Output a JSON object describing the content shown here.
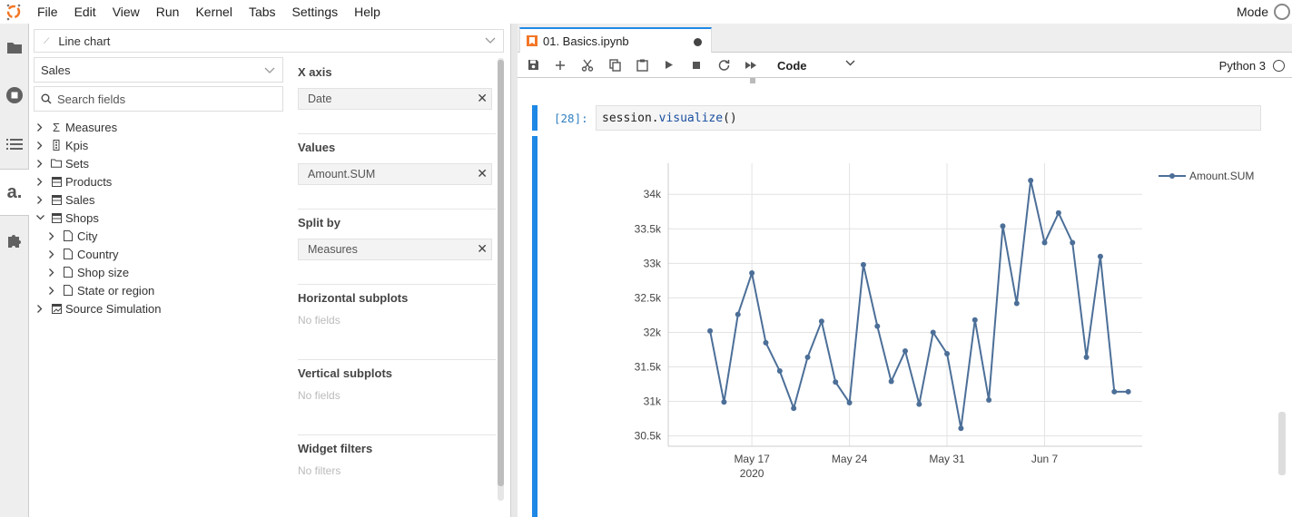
{
  "menubar": {
    "items": [
      "File",
      "Edit",
      "View",
      "Run",
      "Kernel",
      "Tabs",
      "Settings",
      "Help"
    ],
    "mode_label": "Mode"
  },
  "activity_bar": {
    "icons": [
      "folder-icon",
      "running-icon",
      "toc-icon",
      "atoti-icon",
      "extensions-icon"
    ]
  },
  "widget_editor": {
    "widget_type": "Line chart",
    "cube": "Sales",
    "search_placeholder": "Search fields",
    "tree": [
      {
        "label": "Measures",
        "icon": "sigma-icon",
        "expanded": false,
        "level": 0
      },
      {
        "label": "Kpis",
        "icon": "kpi-icon",
        "expanded": false,
        "level": 0
      },
      {
        "label": "Sets",
        "icon": "folder-icon",
        "expanded": false,
        "level": 0
      },
      {
        "label": "Products",
        "icon": "table-icon",
        "expanded": false,
        "level": 0
      },
      {
        "label": "Sales",
        "icon": "table-icon",
        "expanded": false,
        "level": 0
      },
      {
        "label": "Shops",
        "icon": "table-icon",
        "expanded": true,
        "level": 0
      },
      {
        "label": "City",
        "icon": "file-icon",
        "expanded": false,
        "level": 1
      },
      {
        "label": "Country",
        "icon": "file-icon",
        "expanded": false,
        "level": 1
      },
      {
        "label": "Shop size",
        "icon": "file-icon",
        "expanded": false,
        "level": 1
      },
      {
        "label": "State or region",
        "icon": "file-icon",
        "expanded": false,
        "level": 1
      },
      {
        "label": "Source Simulation",
        "icon": "simulation-icon",
        "expanded": false,
        "level": 0
      }
    ],
    "sections": {
      "x_axis": {
        "title": "X axis",
        "field": "Date"
      },
      "values": {
        "title": "Values",
        "field": "Amount.SUM"
      },
      "split_by": {
        "title": "Split by",
        "field": "Measures"
      },
      "horizontal_subplots": {
        "title": "Horizontal subplots",
        "empty": "No fields"
      },
      "vertical_subplots": {
        "title": "Vertical subplots",
        "empty": "No fields"
      },
      "widget_filters": {
        "title": "Widget filters",
        "empty": "No filters"
      }
    }
  },
  "notebook": {
    "tab_label": "01. Basics.ipynb",
    "cell_type": "Code",
    "kernel": "Python 3",
    "prompt": "[28]:",
    "code_obj": "session.",
    "code_fn": "visualize",
    "code_args": "()"
  },
  "colors": {
    "accent": "#1e88e5",
    "series": "#4c6f98"
  },
  "chart_data": {
    "type": "line",
    "title": "",
    "xlabel": "",
    "ylabel": "",
    "x_ticks": [
      "May 17",
      "May 24",
      "May 31",
      "Jun 7"
    ],
    "x_tick_sub": "2020",
    "y_ticks": [
      "30.5k",
      "31k",
      "31.5k",
      "32k",
      "32.5k",
      "33k",
      "33.5k",
      "34k"
    ],
    "ylim": [
      30350,
      34450
    ],
    "xlim": [
      "2020-05-11",
      "2020-06-14"
    ],
    "grid": true,
    "legend_position": "top-right",
    "series": [
      {
        "name": "Amount.SUM",
        "x": [
          "2020-05-14",
          "2020-05-15",
          "2020-05-16",
          "2020-05-17",
          "2020-05-18",
          "2020-05-19",
          "2020-05-20",
          "2020-05-21",
          "2020-05-22",
          "2020-05-23",
          "2020-05-24",
          "2020-05-25",
          "2020-05-26",
          "2020-05-27",
          "2020-05-28",
          "2020-05-29",
          "2020-05-30",
          "2020-05-31",
          "2020-06-01",
          "2020-06-02",
          "2020-06-03",
          "2020-06-04",
          "2020-06-05",
          "2020-06-06",
          "2020-06-07",
          "2020-06-08",
          "2020-06-09",
          "2020-06-10",
          "2020-06-11",
          "2020-06-12",
          "2020-06-13"
        ],
        "values": [
          32020,
          30990,
          32260,
          32860,
          31850,
          31440,
          30900,
          31640,
          32160,
          31280,
          30980,
          32980,
          32090,
          31290,
          31730,
          30960,
          32000,
          31690,
          30610,
          32180,
          31020,
          33540,
          32420,
          34200,
          33300,
          33730,
          33300,
          31640,
          33100,
          31140,
          31140
        ]
      }
    ]
  }
}
